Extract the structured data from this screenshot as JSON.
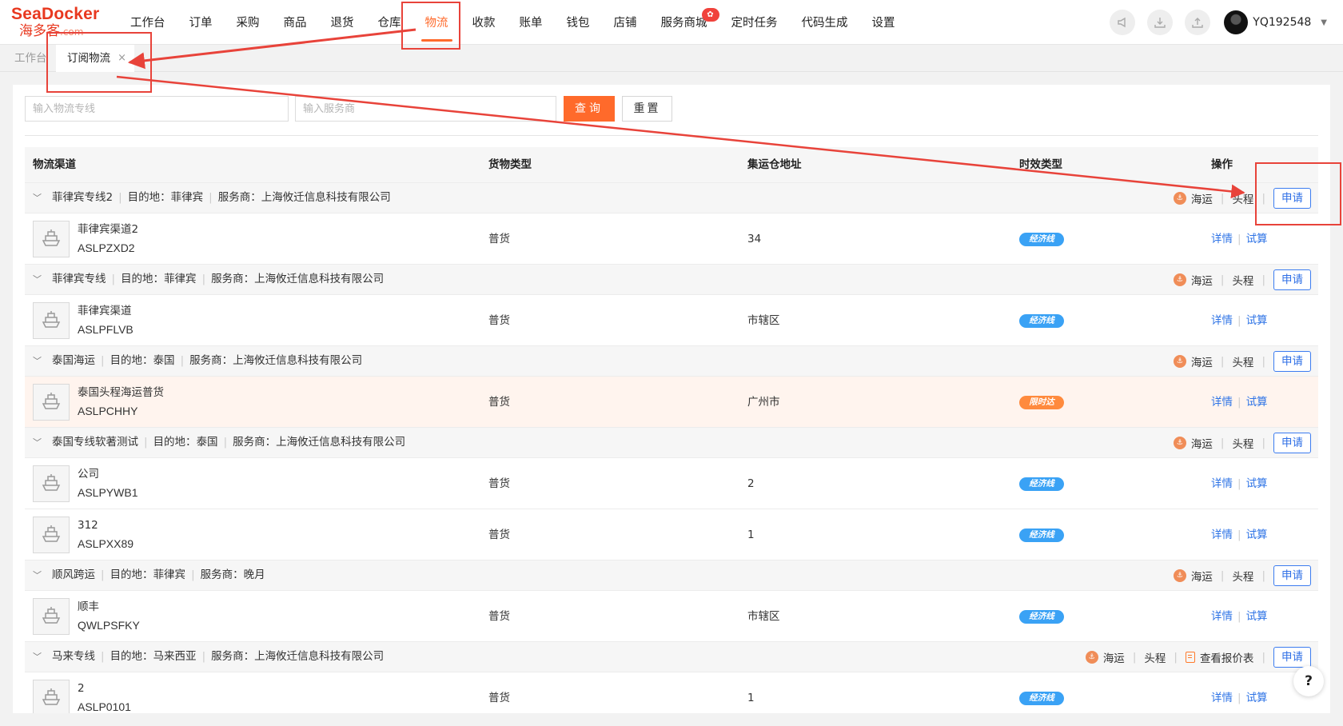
{
  "brand": {
    "logo_en": "SeaDocker",
    "logo_cn": "海多客",
    "logo_suffix": ".com"
  },
  "nav": {
    "items": [
      {
        "label": "工作台"
      },
      {
        "label": "订单"
      },
      {
        "label": "采购"
      },
      {
        "label": "商品"
      },
      {
        "label": "退货"
      },
      {
        "label": "仓库"
      },
      {
        "label": "物流",
        "active": true
      },
      {
        "label": "收款"
      },
      {
        "label": "账单"
      },
      {
        "label": "钱包"
      },
      {
        "label": "店铺"
      },
      {
        "label": "服务商城",
        "badge": "hot"
      },
      {
        "label": "定时任务"
      },
      {
        "label": "代码生成"
      },
      {
        "label": "设置"
      }
    ],
    "right_icons": [
      "announcement-icon",
      "download-icon",
      "upload-icon"
    ],
    "username": "YQ192548",
    "accent_color": "#ff6a2b"
  },
  "tabs": {
    "home": "工作台",
    "current": "订阅物流",
    "close": "×"
  },
  "filters": {
    "channel_placeholder": "输入物流专线",
    "provider_placeholder": "输入服务商",
    "query_label": "查询",
    "reset_label": "重置"
  },
  "table": {
    "headers": {
      "channel": "物流渠道",
      "cargo": "货物类型",
      "warehouse": "集运仓地址",
      "timeliness": "时效类型",
      "ops": "操作"
    },
    "dest_prefix": "目的地：",
    "provider_prefix": "服务商：",
    "ops": {
      "sea": "海运",
      "head": "头程",
      "apply": "申请",
      "quote": "查看报价表",
      "detail": "详情",
      "trial": "试算"
    },
    "groups": [
      {
        "name": "菲律宾专线2",
        "dest": "菲律宾",
        "provider": "上海攸迁信息科技有限公司",
        "rows": [
          {
            "name": "菲律宾渠道2",
            "code": "ASLPZXD2",
            "cargo": "普货",
            "warehouse": "34",
            "tag": "经济线",
            "tag_type": "eco"
          }
        ]
      },
      {
        "name": "菲律宾专线",
        "dest": "菲律宾",
        "provider": "上海攸迁信息科技有限公司",
        "rows": [
          {
            "name": "菲律宾渠道",
            "code": "ASLPFLVB",
            "cargo": "普货",
            "warehouse": "市辖区",
            "tag": "经济线",
            "tag_type": "eco"
          }
        ]
      },
      {
        "name": "泰国海运",
        "dest": "泰国",
        "provider": "上海攸迁信息科技有限公司",
        "rows": [
          {
            "name": "泰国头程海运普货",
            "code": "ASLPCHHY",
            "cargo": "普货",
            "warehouse": "广州市",
            "tag": "限时达",
            "tag_type": "fast",
            "highlight": true
          }
        ]
      },
      {
        "name": "泰国专线软著测试",
        "dest": "泰国",
        "provider": "上海攸迁信息科技有限公司",
        "rows": [
          {
            "name": "公司",
            "code": "ASLPYWB1",
            "cargo": "普货",
            "warehouse": "2",
            "tag": "经济线",
            "tag_type": "eco"
          },
          {
            "name": "312",
            "code": "ASLPXX89",
            "cargo": "普货",
            "warehouse": "1",
            "tag": "经济线",
            "tag_type": "eco"
          }
        ]
      },
      {
        "name": "顺风跨运",
        "dest": "菲律宾",
        "provider": "晚月",
        "rows": [
          {
            "name": "顺丰",
            "code": "QWLPSFKY",
            "cargo": "普货",
            "warehouse": "市辖区",
            "tag": "经济线",
            "tag_type": "eco"
          }
        ]
      },
      {
        "name": "马来专线",
        "dest": "马来西亚",
        "provider": "上海攸迁信息科技有限公司",
        "has_quote": true,
        "rows": [
          {
            "name": "2",
            "code": "ASLP0101",
            "cargo": "普货",
            "warehouse": "1",
            "tag": "经济线",
            "tag_type": "eco"
          }
        ]
      }
    ]
  },
  "help": "?",
  "annotation_color": "#e8433a"
}
